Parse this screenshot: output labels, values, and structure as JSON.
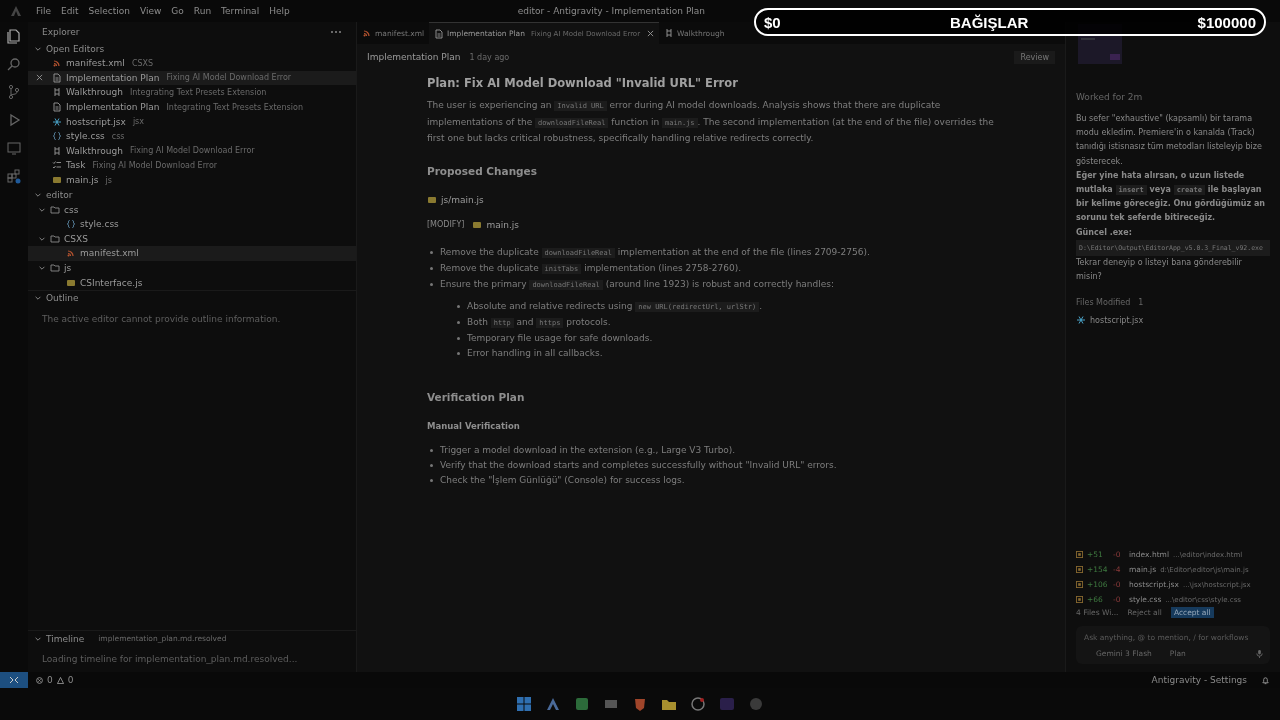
{
  "menu": [
    "File",
    "Edit",
    "Selection",
    "View",
    "Go",
    "Run",
    "Terminal",
    "Help"
  ],
  "window_title": "editor - Antigravity - Implementation Plan",
  "overlay": {
    "left": "$0",
    "center": "BAĞIŞLAR",
    "right": "$100000"
  },
  "sidebar": {
    "title": "Explorer",
    "open_editors": {
      "title": "Open Editors",
      "items": [
        {
          "kind": "rss",
          "name": "manifest.xml",
          "detail": "CSXS",
          "selected": false
        },
        {
          "kind": "doc",
          "name": "Implementation Plan",
          "detail": "Fixing AI Model Download Error",
          "selected": true
        },
        {
          "kind": "walk",
          "name": "Walkthrough",
          "detail": "Integrating Text Presets Extension",
          "selected": false
        },
        {
          "kind": "doc",
          "name": "Implementation Plan",
          "detail": "Integrating Text Presets Extension",
          "selected": false
        },
        {
          "kind": "react",
          "name": "hostscript.jsx",
          "detail": "jsx",
          "selected": false
        },
        {
          "kind": "css",
          "name": "style.css",
          "detail": "css",
          "selected": false
        },
        {
          "kind": "walk",
          "name": "Walkthrough",
          "detail": "Fixing AI Model Download Error",
          "selected": false
        },
        {
          "kind": "task",
          "name": "Task",
          "detail": "Fixing AI Model Download Error",
          "selected": false
        },
        {
          "kind": "js",
          "name": "main.js",
          "detail": "js",
          "selected": false
        }
      ]
    },
    "folder": {
      "title": "editor",
      "tree": [
        {
          "name": "css",
          "kind": "folder",
          "expanded": true,
          "children": [
            {
              "name": "style.css",
              "kind": "css",
              "selected": false
            }
          ]
        },
        {
          "name": "CSXS",
          "kind": "folder",
          "expanded": true,
          "children": [
            {
              "name": "manifest.xml",
              "kind": "rss",
              "selected": true
            }
          ]
        },
        {
          "name": "js",
          "kind": "folder",
          "expanded": true,
          "children": [
            {
              "name": "CSInterface.js",
              "kind": "js",
              "selected": false
            }
          ]
        }
      ]
    },
    "outline": {
      "title": "Outline",
      "message": "The active editor cannot provide outline information."
    },
    "timeline": {
      "title": "Timeline",
      "file": "implementation_plan.md.resolved",
      "message": "Loading timeline for implementation_plan.md.resolved..."
    }
  },
  "tabs": [
    {
      "kind": "rss",
      "label": "manifest.xml",
      "selected": false
    },
    {
      "kind": "doc",
      "label": "Implementation Plan",
      "detail": "Fixing AI Model Download Error",
      "selected": true
    },
    {
      "kind": "walk",
      "label": "Walkthrough",
      "selected": false
    }
  ],
  "doc_header": {
    "title": "Implementation Plan",
    "time": "1 day ago",
    "review": "Review"
  },
  "doc": {
    "title": "Plan: Fix AI Model Download \"Invalid URL\" Error",
    "intro": [
      {
        "kind": "text",
        "text": "The user is experiencing an "
      },
      {
        "kind": "code",
        "text": "Invalid URL"
      },
      {
        "kind": "text",
        "text": " error during AI model downloads. Analysis shows that there are duplicate implementations of the "
      },
      {
        "kind": "code",
        "text": "downloadFileReal"
      },
      {
        "kind": "text",
        "text": " function in "
      },
      {
        "kind": "code",
        "text": "main.js"
      },
      {
        "kind": "text",
        "text": ". The second implementation (at the end of the file) overrides the first one but lacks critical robustness, specifically handling relative redirects correctly."
      }
    ],
    "changes_title": "Proposed Changes",
    "file_path": "js/main.js",
    "modify_tag": "[MODIFY]",
    "modify_file": "main.js",
    "changes": [
      {
        "parts": [
          {
            "kind": "text",
            "text": "Remove the duplicate "
          },
          {
            "kind": "code",
            "text": "downloadFileReal"
          },
          {
            "kind": "text",
            "text": " implementation at the end of the file (lines 2709-2756)."
          }
        ]
      },
      {
        "parts": [
          {
            "kind": "text",
            "text": "Remove the duplicate "
          },
          {
            "kind": "code",
            "text": "initTabs"
          },
          {
            "kind": "text",
            "text": " implementation (lines 2758-2760)."
          }
        ]
      },
      {
        "parts": [
          {
            "kind": "text",
            "text": "Ensure the primary "
          },
          {
            "kind": "code",
            "text": "downloadFileReal"
          },
          {
            "kind": "text",
            "text": " (around line 1923) is robust and correctly handles:"
          }
        ],
        "children": [
          [
            {
              "kind": "text",
              "text": "Absolute and relative redirects using "
            },
            {
              "kind": "code",
              "text": "new URL(redirectUrl, urlStr)"
            },
            {
              "kind": "text",
              "text": "."
            }
          ],
          [
            {
              "kind": "text",
              "text": "Both "
            },
            {
              "kind": "code",
              "text": "http"
            },
            {
              "kind": "text",
              "text": " and "
            },
            {
              "kind": "code",
              "text": "https"
            },
            {
              "kind": "text",
              "text": " protocols."
            }
          ],
          [
            {
              "kind": "text",
              "text": "Temporary file usage for safe downloads."
            }
          ],
          [
            {
              "kind": "text",
              "text": "Error handling in all callbacks."
            }
          ]
        ]
      }
    ],
    "verify_title": "Verification Plan",
    "manual_title": "Manual Verification",
    "verify": [
      "Trigger a model download in the extension (e.g., Large V3 Turbo).",
      "Verify that the download starts and completes successfully without \"Invalid URL\" errors.",
      "Check the \"İşlem Günlüğü\" (Console) for success logs."
    ]
  },
  "agent": {
    "worked": "Worked for 2m",
    "message": "Bu sefer \"exhaustive\" (kapsamlı) bir tarama modu ekledim. Premiere'in o kanalda (Track) tanıdığı istisnasız tüm metodları listeleyip bize gösterecek.",
    "bold": [
      {
        "kind": "text",
        "text": "Eğer yine hata alırsan, o uzun listede mutlaka "
      },
      {
        "kind": "code",
        "text": "insert"
      },
      {
        "kind": "text",
        "text": " veya "
      },
      {
        "kind": "code",
        "text": "create"
      },
      {
        "kind": "text",
        "text": " ile başlayan bir kelime göreceğiz. Onu gördüğümüz an sorunu tek seferde bitireceğiz."
      }
    ],
    "exe_label": "Güncel .exe:",
    "exe_path": "D:\\Editor\\Output\\EditorApp_v5.0.3_Final_v92.exe",
    "ask": "Tekrar deneyip o listeyi bana gönderebilir misin?",
    "files_title": "Files Modified",
    "files_count": "1",
    "file": "hostscript.jsx",
    "changed": [
      {
        "add": "+51",
        "del": "-0",
        "name": "index.html",
        "path": "...\\editor\\index.html"
      },
      {
        "add": "+154",
        "del": "-4",
        "name": "main.js",
        "path": "d:\\Editor\\editor\\js\\main.js"
      },
      {
        "add": "+106",
        "del": "-0",
        "name": "hostscript.jsx",
        "path": "...\\jsx\\hostscript.jsx"
      },
      {
        "add": "+66",
        "del": "-0",
        "name": "style.css",
        "path": "...\\editor\\css\\style.css"
      }
    ],
    "files_summary": "4 Files Wi...",
    "reject": "Reject all",
    "accept": "Accept all",
    "input_placeholder": "Ask anything, @ to mention, / for workflows",
    "model": "Gemini 3 Flash",
    "mode": "Plan"
  },
  "status": {
    "errors": "0",
    "warnings": "0",
    "right": "Antigravity - Settings"
  }
}
